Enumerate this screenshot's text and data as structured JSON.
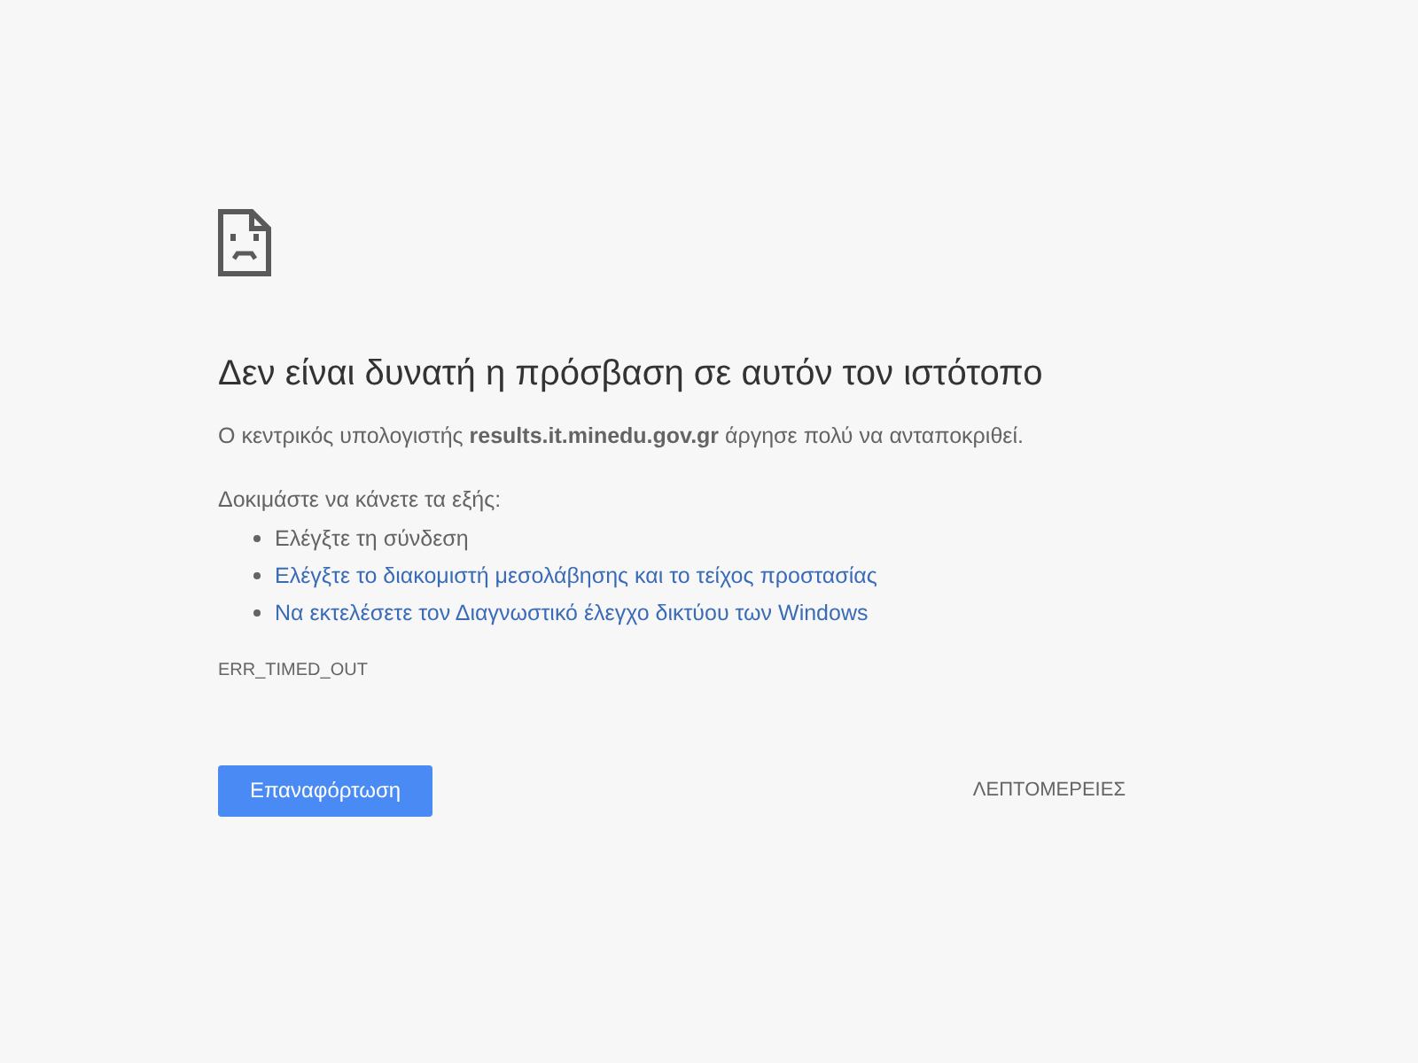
{
  "heading": "Δεν είναι δυνατή η πρόσβαση σε αυτόν τον ιστότοπο",
  "message": "Ο κεντρικός υπολογιστής **results.it.minedu.gov.gr** άργησε πολύ να ανταποκριθεί.",
  "suggestions_title": "Δοκιμάστε να κάνετε τα εξής:",
  "suggestions": [
    {
      "kind": "text",
      "label": "Ελέγξτε τη σύνδεση"
    },
    {
      "kind": "link",
      "label": "Ελέγξτε το διακομιστή μεσολάβησης και το τείχος προστασίας"
    },
    {
      "kind": "link",
      "label": "Να εκτελέσετε τον Διαγνωστικό έλεγχο δικτύου των Windows"
    }
  ],
  "error_code": "ERR_TIMED_OUT",
  "buttons": {
    "reload": "Επαναφόρτωση",
    "details": "ΛΕΠΤΟΜΕΡΕΙΕΣ"
  }
}
